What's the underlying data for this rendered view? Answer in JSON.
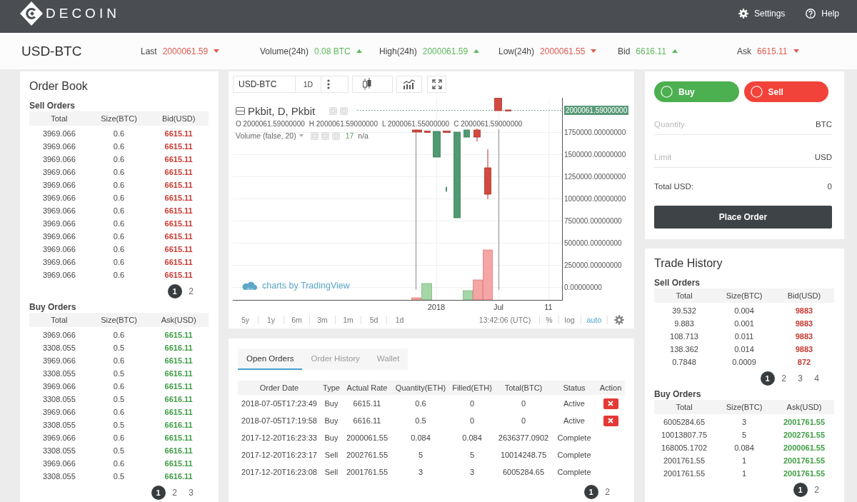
{
  "header": {
    "brand": "DECOIN",
    "links": [
      {
        "label": "Settings",
        "kind": "settings"
      },
      {
        "label": "Help",
        "kind": "help"
      }
    ]
  },
  "market": {
    "pair": "USD-BTC",
    "stats": [
      {
        "label": "Last",
        "value": "2000061.59",
        "rising": false
      },
      {
        "label": "Volume(24h)",
        "value": "0.08 BTC",
        "rising": true
      },
      {
        "label": "High(24h)",
        "value": "2000061.59",
        "rising": true
      },
      {
        "label": "Low(24h)",
        "value": "2000061.55",
        "rising": false
      },
      {
        "label": "Bid",
        "value": "6616.11",
        "rising": true
      },
      {
        "label": "Ask",
        "value": "6615.11",
        "rising": false
      }
    ]
  },
  "order_book": {
    "title": "Order Book",
    "sections": [
      {
        "title": "Sell Orders",
        "kind": "sell",
        "columns": [
          "Total",
          "Size(BTC)",
          "Bid(USD)"
        ],
        "rows": [
          [
            "3969.066",
            "0.6",
            "6615.11"
          ],
          [
            "3969.066",
            "0.6",
            "6615.11"
          ],
          [
            "3969.066",
            "0.6",
            "6615.11"
          ],
          [
            "3969.066",
            "0.6",
            "6615.11"
          ],
          [
            "3969.066",
            "0.6",
            "6615.11"
          ],
          [
            "3969.066",
            "0.6",
            "6615.11"
          ],
          [
            "3969.066",
            "0.6",
            "6615.11"
          ],
          [
            "3969.066",
            "0.6",
            "6615.11"
          ],
          [
            "3969.066",
            "0.6",
            "6615.11"
          ],
          [
            "3969.066",
            "0.6",
            "6615.11"
          ],
          [
            "3969.066",
            "0.6",
            "6615.11"
          ],
          [
            "3969.066",
            "0.6",
            "6615.11"
          ]
        ],
        "pages": [
          {
            "label": "1",
            "selected": true
          },
          {
            "label": "2",
            "selected": false
          }
        ]
      },
      {
        "title": "Buy Orders",
        "kind": "buy",
        "columns": [
          "Total",
          "Size(BTC)",
          "Ask(USD)"
        ],
        "rows": [
          [
            "3969.066",
            "0.6",
            "6615.11"
          ],
          [
            "3308.055",
            "0.5",
            "6616.11"
          ],
          [
            "3969.066",
            "0.6",
            "6615.11"
          ],
          [
            "3308.055",
            "0.5",
            "6616.11"
          ],
          [
            "3969.066",
            "0.6",
            "6615.11"
          ],
          [
            "3308.055",
            "0.5",
            "6616.11"
          ],
          [
            "3969.066",
            "0.6",
            "6615.11"
          ],
          [
            "3308.055",
            "0.5",
            "6616.11"
          ],
          [
            "3969.066",
            "0.6",
            "6615.11"
          ],
          [
            "3308.055",
            "0.5",
            "6616.11"
          ],
          [
            "3969.066",
            "0.6",
            "6615.11"
          ],
          [
            "3308.055",
            "0.5",
            "6616.11"
          ]
        ],
        "pages": [
          {
            "label": "1",
            "selected": true
          },
          {
            "label": "2",
            "selected": false
          },
          {
            "label": "3",
            "selected": false
          }
        ]
      }
    ]
  },
  "chart": {
    "symbol": "USD-BTC",
    "interval": "1D",
    "legend": {
      "title": "Pkbit, D, Pkbit",
      "ohlc": [
        "O 2000061.59000000",
        "H 2000061.59000000",
        "L 2000061.55000000",
        "C 2000061.59000000"
      ],
      "volume": "Volume (false, 20)",
      "volume_value": "17",
      "volume_note": "n/a"
    },
    "price_label": "2000061.59000000",
    "y_labels": [
      "1750000.00000000",
      "1500000.00000000",
      "1250000.00000000",
      "1000000.00000000",
      "750000.00000000",
      "500000.00000000",
      "250000.00000000",
      "0.00000000"
    ],
    "x_labels": [
      "2018",
      "Jul",
      "11"
    ],
    "credit": "charts by TradingView",
    "ranges": [
      "5y",
      "1y",
      "6m",
      "3m",
      "1m",
      "5d",
      "1d"
    ],
    "time": "13:42:06 (UTC)",
    "options": [
      {
        "label": "%",
        "selected": false
      },
      {
        "label": "log",
        "selected": false
      },
      {
        "label": "auto",
        "selected": true
      }
    ]
  },
  "orders": {
    "tabs": [
      {
        "label": "Open Orders",
        "selected": true
      },
      {
        "label": "Order History",
        "selected": false
      },
      {
        "label": "Wallet",
        "selected": false
      }
    ],
    "columns": [
      "Order Date",
      "Type",
      "Actual Rate",
      "Quantity(ETH)",
      "Filled(ETH)",
      "Total(BTC)",
      "Status",
      "Action"
    ],
    "rows": [
      {
        "cells": [
          "2018-07-05T17:23:49",
          "Buy",
          "6615.11",
          "0.6",
          "0",
          "0",
          "Active"
        ],
        "cancelable": true
      },
      {
        "cells": [
          "2018-07-05T17:19:58",
          "Buy",
          "6616.11",
          "0.5",
          "0",
          "0",
          "Active"
        ],
        "cancelable": true
      },
      {
        "cells": [
          "2017-12-20T16:23:33",
          "Buy",
          "2000061.55",
          "0.084",
          "0.084",
          "2636377.0902",
          "Complete"
        ],
        "cancelable": false
      },
      {
        "cells": [
          "2017-12-20T16:23:17",
          "Sell",
          "2002761.55",
          "5",
          "5",
          "10014248.75",
          "Complete"
        ],
        "cancelable": false
      },
      {
        "cells": [
          "2017-12-20T16:23:08",
          "Sell",
          "2001761.55",
          "3",
          "3",
          "6005284.65",
          "Complete"
        ],
        "cancelable": false
      }
    ],
    "pages": [
      {
        "label": "1",
        "selected": true
      },
      {
        "label": "2",
        "selected": false
      }
    ]
  },
  "order_form": {
    "sides": [
      {
        "label": "Buy",
        "kind": "buy",
        "selected": false
      },
      {
        "label": "Sell",
        "kind": "sell",
        "selected": false
      }
    ],
    "fields": [
      {
        "placeholder": "Quantity",
        "unit": "BTC"
      },
      {
        "placeholder": "Limit",
        "unit": "USD"
      }
    ],
    "total": {
      "label": "Total USD:",
      "value": "0"
    },
    "submit": "Place Order"
  },
  "trade_history": {
    "title": "Trade History",
    "sections": [
      {
        "title": "Sell Orders",
        "kind": "sell",
        "columns": [
          "Total",
          "Size(BTC)",
          "Bid(USD)"
        ],
        "rows": [
          [
            "39.532",
            "0.004",
            "9883"
          ],
          [
            "9.883",
            "0.001",
            "9883"
          ],
          [
            "108.713",
            "0.011",
            "9883"
          ],
          [
            "138.362",
            "0.014",
            "9883"
          ],
          [
            "0.7848",
            "0.0009",
            "872"
          ]
        ],
        "pages": [
          {
            "label": "1",
            "selected": true
          },
          {
            "label": "2",
            "selected": false
          },
          {
            "label": "3",
            "selected": false
          },
          {
            "label": "4",
            "selected": false
          }
        ]
      },
      {
        "title": "Buy Orders",
        "kind": "buy",
        "columns": [
          "Total",
          "Size(BTC)",
          "Ask(USD)"
        ],
        "rows": [
          [
            "6005284.65",
            "3",
            "2001761.55"
          ],
          [
            "10013807.75",
            "5",
            "2002761.55"
          ],
          [
            "168005.1702",
            "0.084",
            "2000061.55"
          ],
          [
            "2001761.55",
            "1",
            "2001761.55"
          ],
          [
            "2001761.55",
            "1",
            "2001761.55"
          ]
        ],
        "pages": [
          {
            "label": "1",
            "selected": true
          },
          {
            "label": "2",
            "selected": false
          }
        ]
      }
    ]
  }
}
